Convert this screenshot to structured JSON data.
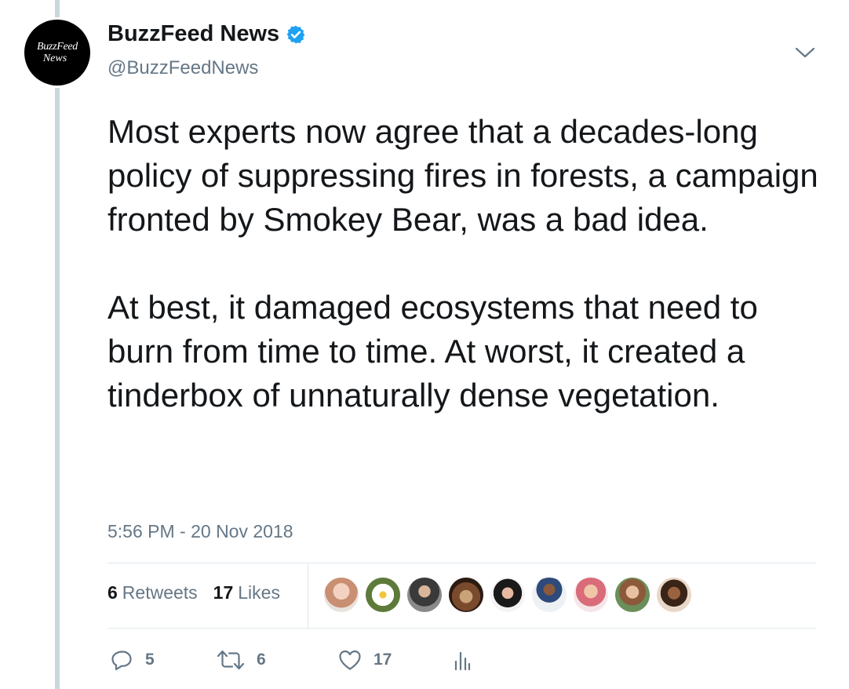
{
  "author": {
    "avatar_text_line1": "BuzzFeed",
    "avatar_text_line2": "News",
    "display_name": "BuzzFeed News",
    "handle": "@BuzzFeedNews",
    "verified": true
  },
  "tweet": {
    "paragraphs": [
      "Most experts now agree that a decades-long policy of suppressing fires in forests, a campaign fronted by Smokey Bear, was a bad idea.",
      "At best, it damaged ecosystems that need to burn from time to time. At worst, it created a tinderbox of unnaturally dense vegetation."
    ],
    "timestamp": "5:56 PM - 20 Nov 2018"
  },
  "stats": {
    "retweets_count": "6",
    "retweets_label": "Retweets",
    "likes_count": "17",
    "likes_label": "Likes"
  },
  "liker_avatars": [
    "avatar-1",
    "avatar-2",
    "avatar-3",
    "avatar-4",
    "avatar-5",
    "avatar-6",
    "avatar-7",
    "avatar-8",
    "avatar-9"
  ],
  "actions": {
    "reply_count": "5",
    "retweet_count": "6",
    "like_count": "17"
  },
  "icons": [
    "verified-icon",
    "chevron-down-icon",
    "reply-icon",
    "retweet-icon",
    "heart-icon",
    "analytics-icon"
  ],
  "colors": {
    "verified_blue": "#1da1f2",
    "muted_text": "#657786",
    "divider": "#e1e8ed",
    "thread_line": "#ccd6dd"
  }
}
